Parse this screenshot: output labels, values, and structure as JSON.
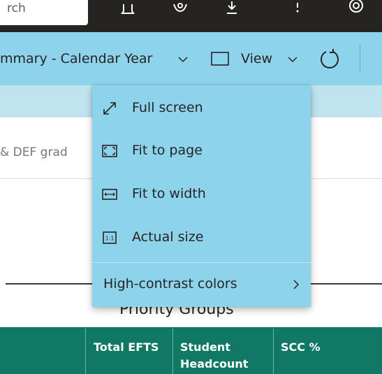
{
  "header": {
    "search_text": "rch",
    "icons": [
      "bell-icon",
      "gear-icon",
      "download-icon",
      "help-icon",
      "account-icon"
    ]
  },
  "toolbar": {
    "report_title": "mmary - Calendar Year",
    "view_label": "View",
    "icons": [
      "chevron-down-icon",
      "view-icon",
      "refresh-icon"
    ]
  },
  "report": {
    "partial_label": "& DEF grad",
    "section_title": "Priority Groups",
    "table_headers": [
      "Total EFTS",
      "Student Headcount",
      "SCC %"
    ]
  },
  "view_menu": {
    "items": [
      {
        "label": "Full screen",
        "icon": "full-screen-icon"
      },
      {
        "label": "Fit to page",
        "icon": "fit-to-page-icon"
      },
      {
        "label": "Fit to width",
        "icon": "fit-to-width-icon"
      },
      {
        "label": "Actual size",
        "icon": "actual-size-icon"
      }
    ],
    "high_contrast_label": "High-contrast colors",
    "actual_size_glyph": "1:1"
  },
  "colors": {
    "top_bar": "#252423",
    "toolbar": "#8ed3ec",
    "menu": "#8ed3ec",
    "table_header": "#117865"
  }
}
